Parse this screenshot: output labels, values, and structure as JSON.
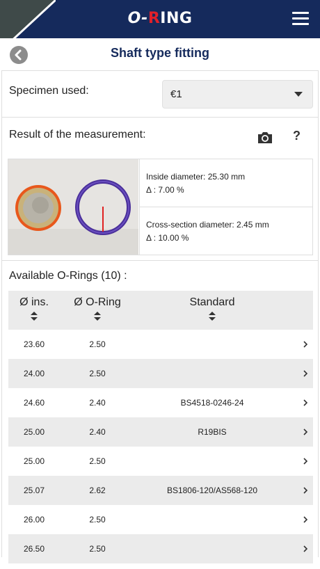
{
  "header": {
    "logo_prefix": "O-",
    "logo_r": "R",
    "logo_suffix": "ING",
    "menu_icon": "hamburger-menu-icon",
    "background_color": "#152a5c",
    "accent_color": "#e0202a"
  },
  "subheader": {
    "title": "Shaft type fitting",
    "back_icon": "back-arrow-icon"
  },
  "specimen": {
    "label": "Specimen used:",
    "value": "€1"
  },
  "result": {
    "label": "Result of the measurement:",
    "camera_icon": "camera-icon",
    "help_label": "?",
    "inside_diameter": "Inside diameter: 25.30 mm",
    "inside_delta": "Δ : 7.00 %",
    "cross_section": "Cross-section diameter: 2.45 mm",
    "cross_delta": "Δ : 10.00 %"
  },
  "available": {
    "title": "Available O-Rings (10) :",
    "columns": [
      "Ø ins.",
      "Ø O-Ring",
      "Standard"
    ],
    "rows": [
      {
        "ins": "23.60",
        "ring": "2.50",
        "standard": ""
      },
      {
        "ins": "24.00",
        "ring": "2.50",
        "standard": ""
      },
      {
        "ins": "24.60",
        "ring": "2.40",
        "standard": "BS4518-0246-24"
      },
      {
        "ins": "25.00",
        "ring": "2.40",
        "standard": "R19BIS"
      },
      {
        "ins": "25.00",
        "ring": "2.50",
        "standard": ""
      },
      {
        "ins": "25.07",
        "ring": "2.62",
        "standard": "BS1806-120/AS568-120"
      },
      {
        "ins": "26.00",
        "ring": "2.50",
        "standard": ""
      },
      {
        "ins": "26.50",
        "ring": "2.50",
        "standard": ""
      }
    ]
  }
}
